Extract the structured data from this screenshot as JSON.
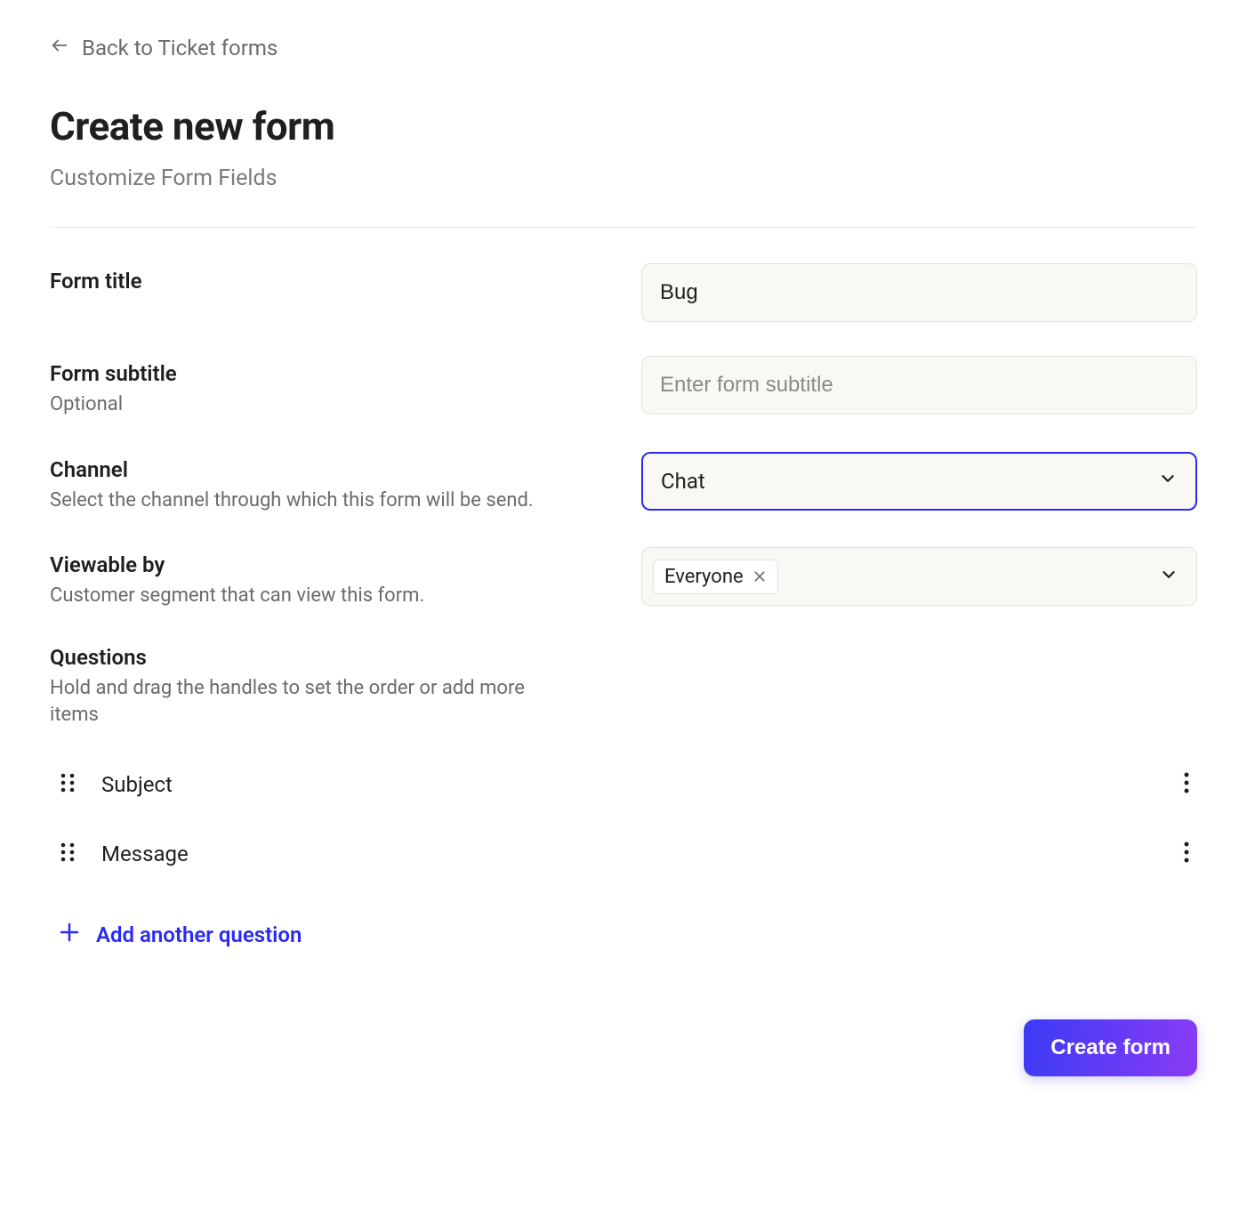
{
  "nav": {
    "back_label": "Back to Ticket forms"
  },
  "header": {
    "title": "Create new form",
    "subtitle": "Customize Form Fields"
  },
  "fields": {
    "title": {
      "label": "Form title",
      "value": "Bug"
    },
    "subtitle": {
      "label": "Form subtitle",
      "help": "Optional",
      "placeholder": "Enter form subtitle",
      "value": ""
    },
    "channel": {
      "label": "Channel",
      "help": "Select the channel through which this form will be send.",
      "value": "Chat"
    },
    "viewable": {
      "label": "Viewable by",
      "help": "Customer segment that can view this form.",
      "tags": [
        "Everyone"
      ]
    }
  },
  "questions_section": {
    "label": "Questions",
    "help": "Hold and drag the handles to set the order or add more items",
    "items": [
      {
        "label": "Subject"
      },
      {
        "label": "Message"
      }
    ],
    "add_label": "Add another question"
  },
  "actions": {
    "submit_label": "Create form"
  }
}
